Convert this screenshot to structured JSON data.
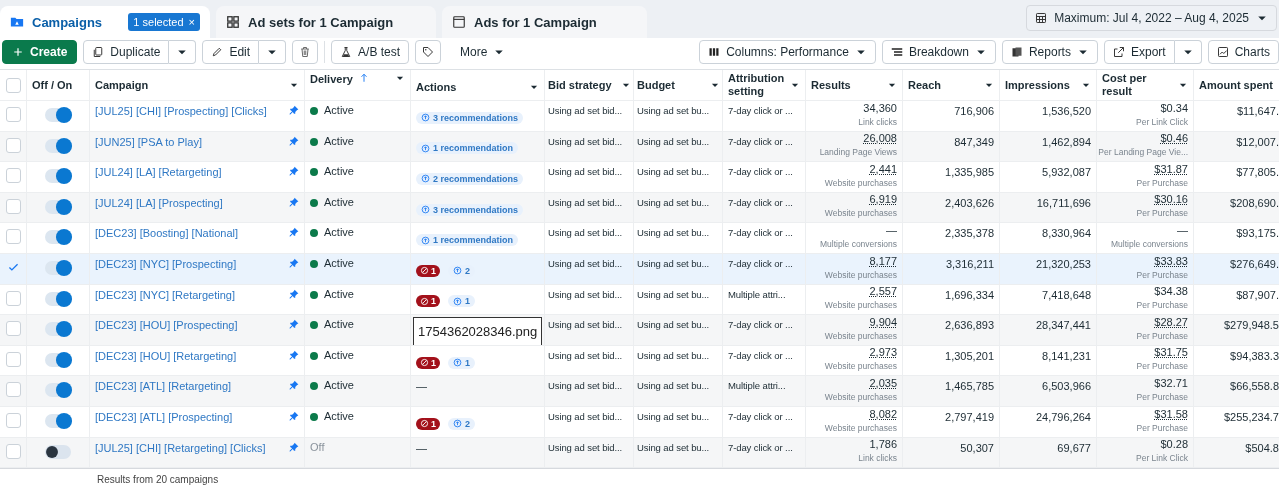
{
  "tabs": [
    {
      "label": "Campaigns",
      "selected": true,
      "chip": "1 selected",
      "chip_close": "×"
    },
    {
      "label": "Ad sets for 1 Campaign",
      "selected": false
    },
    {
      "label": "Ads for 1 Campaign",
      "selected": false
    }
  ],
  "date_range": "Maximum: Jul 4, 2022 – Aug 4, 2025",
  "toolbar_left": [
    {
      "kind": "primary",
      "label": "Create"
    },
    {
      "kind": "split",
      "label": "Duplicate"
    },
    {
      "kind": "split",
      "label": "Edit"
    },
    {
      "kind": "icon"
    },
    {
      "kind": "plain",
      "label": "A/B test"
    },
    {
      "kind": "icon"
    },
    {
      "kind": "menu",
      "label": "More"
    }
  ],
  "toolbar_right": [
    {
      "kind": "menu",
      "label": "Columns: Performance"
    },
    {
      "kind": "menu",
      "label": "Breakdown"
    },
    {
      "kind": "menu",
      "label": "Reports"
    },
    {
      "kind": "split",
      "label": "Export"
    },
    {
      "kind": "plain",
      "label": "Charts"
    }
  ],
  "table": {
    "select_all_checked": false,
    "columns": [
      {
        "label": "Off / On",
        "sorted": false
      },
      {
        "label": "Campaign",
        "sorted": false
      },
      {
        "label": "Delivery",
        "sorted": true
      },
      {
        "label": "Actions",
        "sorted": false
      },
      {
        "label": "Bid strategy",
        "sorted": false
      },
      {
        "label": "Budget",
        "sorted": false
      },
      {
        "label": "Attribution setting",
        "sorted": false
      },
      {
        "label": "Results",
        "sorted": false
      },
      {
        "label": "Reach",
        "sorted": false
      },
      {
        "label": "Impressions",
        "sorted": false
      },
      {
        "label": "Cost per result",
        "sorted": false
      },
      {
        "label": "Amount spent",
        "sorted": false
      }
    ],
    "rows": [
      {
        "selected": false,
        "on": true,
        "campaign": "[JUL25] [CHI] [Prospecting] [Clicks]",
        "delivery": "Active",
        "active": true,
        "actions": {
          "recommendation": "3 recommendations"
        },
        "bid": "Using ad set bid...",
        "budget": "Using ad set bu...",
        "attribution": "7-day click or ...",
        "result": "34,360",
        "result_underlined": false,
        "result_type": "Link clicks",
        "reach": "716,906",
        "impressions": "1,536,520",
        "cost": "$0.34",
        "cost_underlined": false,
        "cost_type": "Per Link Click",
        "spent": "$11,647."
      },
      {
        "selected": false,
        "on": true,
        "campaign": "[JUN25] [PSA to Play]",
        "delivery": "Active",
        "active": true,
        "actions": {
          "recommendation": "1 recommendation"
        },
        "bid": "Using ad set bid...",
        "budget": "Using ad set bu...",
        "attribution": "7-day click or ...",
        "result": "26,008",
        "result_underlined": true,
        "result_type": "Landing Page Views",
        "reach": "847,349",
        "impressions": "1,462,894",
        "cost": "$0.46",
        "cost_underlined": true,
        "cost_type": "Per Landing Page Vie...",
        "spent": "$12,007."
      },
      {
        "selected": false,
        "on": true,
        "campaign": "[JUL24] [LA] [Retargeting]",
        "delivery": "Active",
        "active": true,
        "actions": {
          "recommendation": "2 recommendations"
        },
        "bid": "Using ad set bid...",
        "budget": "Using ad set bu...",
        "attribution": "7-day click or ...",
        "result": "2,441",
        "result_underlined": true,
        "result_type": "Website purchases",
        "reach": "1,335,985",
        "impressions": "5,932,087",
        "cost": "$31.87",
        "cost_underlined": true,
        "cost_type": "Per Purchase",
        "spent": "$77,805."
      },
      {
        "selected": false,
        "on": true,
        "campaign": "[JUL24] [LA] [Prospecting]",
        "delivery": "Active",
        "active": true,
        "actions": {
          "recommendation": "3 recommendations"
        },
        "bid": "Using ad set bid...",
        "budget": "Using ad set bu...",
        "attribution": "7-day click or ...",
        "result": "6,919",
        "result_underlined": true,
        "result_type": "Website purchases",
        "reach": "2,403,626",
        "impressions": "16,711,696",
        "cost": "$30.16",
        "cost_underlined": true,
        "cost_type": "Per Purchase",
        "spent": "$208,690."
      },
      {
        "selected": false,
        "on": true,
        "campaign": "[DEC23] [Boosting] [National]",
        "delivery": "Active",
        "active": true,
        "actions": {
          "recommendation": "1 recommendation"
        },
        "bid": "Using ad set bid...",
        "budget": "Using ad set bu...",
        "attribution": "7-day click or ...",
        "result": "—",
        "result_underlined": false,
        "result_type": "Multiple conversions",
        "reach": "2,335,378",
        "impressions": "8,330,964",
        "cost": "—",
        "cost_underlined": false,
        "cost_type": "Multiple conversions",
        "spent": "$93,175."
      },
      {
        "selected": true,
        "on": true,
        "campaign": "[DEC23] [NYC] [Prospecting]",
        "delivery": "Active",
        "active": true,
        "actions": {
          "error": "1",
          "recommendation": "2"
        },
        "bid": "Using ad set bid...",
        "budget": "Using ad set bu...",
        "attribution": "7-day click or ...",
        "result": "8,177",
        "result_underlined": true,
        "result_type": "Website purchases",
        "reach": "3,316,211",
        "impressions": "21,320,253",
        "cost": "$33.83",
        "cost_underlined": true,
        "cost_type": "Per Purchase",
        "spent": "$276,649."
      },
      {
        "selected": false,
        "on": true,
        "campaign": "[DEC23] [NYC] [Retargeting]",
        "delivery": "Active",
        "active": true,
        "actions": {
          "error": "1",
          "recommendation": "1"
        },
        "bid": "Using ad set bid...",
        "budget": "Using ad set bu...",
        "attribution": "Multiple attri...",
        "result": "2,557",
        "result_underlined": true,
        "result_type": "Website purchases",
        "reach": "1,696,334",
        "impressions": "7,418,648",
        "cost": "$34.38",
        "cost_underlined": false,
        "cost_type": "Per Purchase",
        "spent": "$87,907."
      },
      {
        "selected": false,
        "on": true,
        "campaign": "[DEC23] [HOU] [Prospecting]",
        "delivery": "Active",
        "active": true,
        "actions": {},
        "bid": "Using ad set bid...",
        "budget": "Using ad set bu...",
        "attribution": "7-day click or ...",
        "result": "9,904",
        "result_underlined": true,
        "result_type": "Website purchases",
        "reach": "2,636,893",
        "impressions": "28,347,441",
        "cost": "$28.27",
        "cost_underlined": true,
        "cost_type": "Per Purchase",
        "spent": "$279,948.5"
      },
      {
        "selected": false,
        "on": true,
        "campaign": "[DEC23] [HOU] [Retargeting]",
        "delivery": "Active",
        "active": true,
        "actions": {
          "error": "1",
          "recommendation": "1"
        },
        "bid": "Using ad set bid...",
        "budget": "Using ad set bu...",
        "attribution": "7-day click or ...",
        "result": "2,973",
        "result_underlined": true,
        "result_type": "Website purchases",
        "reach": "1,305,201",
        "impressions": "8,141,231",
        "cost": "$31.75",
        "cost_underlined": true,
        "cost_type": "Per Purchase",
        "spent": "$94,383.3"
      },
      {
        "selected": false,
        "on": true,
        "campaign": "[DEC23] [ATL] [Retargeting]",
        "delivery": "Active",
        "active": true,
        "actions": {
          "text": "—"
        },
        "bid": "Using ad set bid...",
        "budget": "Using ad set bu...",
        "attribution": "Multiple attri...",
        "result": "2,035",
        "result_underlined": true,
        "result_type": "Website purchases",
        "reach": "1,465,785",
        "impressions": "6,503,966",
        "cost": "$32.71",
        "cost_underlined": false,
        "cost_type": "Per Purchase",
        "spent": "$66,558.8"
      },
      {
        "selected": false,
        "on": true,
        "campaign": "[DEC23] [ATL] [Prospecting]",
        "delivery": "Active",
        "active": true,
        "actions": {
          "error": "1",
          "recommendation": "2"
        },
        "bid": "Using ad set bid...",
        "budget": "Using ad set bu...",
        "attribution": "7-day click or ...",
        "result": "8,082",
        "result_underlined": true,
        "result_type": "Website purchases",
        "reach": "2,797,419",
        "impressions": "24,796,264",
        "cost": "$31.58",
        "cost_underlined": true,
        "cost_type": "Per Purchase",
        "spent": "$255,234.7"
      },
      {
        "selected": false,
        "on": false,
        "campaign": "[JUL25] [CHI] [Retargeting] [Clicks]",
        "delivery": "Off",
        "active": false,
        "actions": {
          "text": "—"
        },
        "bid": "Using ad set bid...",
        "budget": "Using ad set bu...",
        "attribution": "7-day click or ...",
        "result": "1,786",
        "result_underlined": false,
        "result_type": "Link clicks",
        "reach": "50,307",
        "impressions": "69,677",
        "cost": "$0.28",
        "cost_underlined": false,
        "cost_type": "Per Link Click",
        "spent": "$504.8"
      }
    ],
    "footer": "Results from 20 campaigns"
  },
  "file_label": "1754362028346.png"
}
